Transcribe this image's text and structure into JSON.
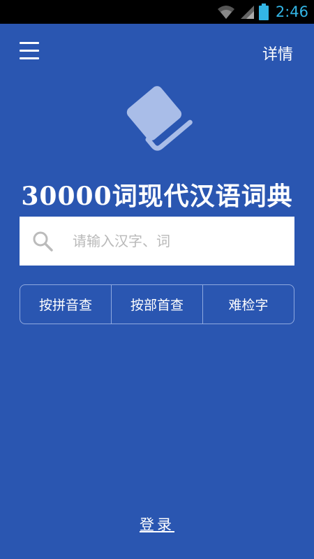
{
  "status_bar": {
    "time": "2:46",
    "icons": [
      "wifi-icon",
      "signal-icon",
      "battery-icon"
    ],
    "time_color": "#33b5e5"
  },
  "header": {
    "menu_icon": "hamburger-menu-icon",
    "detail_label": "详情"
  },
  "logo_icon": "book-icon",
  "app_title": "30000词现代汉语词典",
  "search": {
    "placeholder": "请输入汉字、词",
    "icon": "search-icon"
  },
  "lookup_buttons": [
    {
      "label": "按拼音查"
    },
    {
      "label": "按部首查"
    },
    {
      "label": "难检字"
    }
  ],
  "login_label": "登录",
  "colors": {
    "background": "#2a56b1",
    "logo": "#a9bde8"
  }
}
